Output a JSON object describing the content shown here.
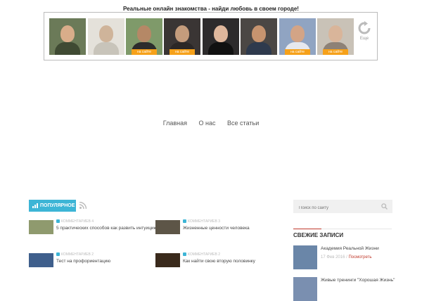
{
  "banner": {
    "title": "Реальные онлайн знакомства - найди любовь в своем городе!",
    "online_label": "на сайте",
    "more_label": "Еще",
    "photos": [
      {
        "bg": "#6b7a58",
        "skin": "#d9ad8a",
        "body": "#3f4a33",
        "online": false
      },
      {
        "bg": "#e4e1da",
        "skin": "#cfb49a",
        "body": "#c8c4ba",
        "online": false
      },
      {
        "bg": "#7f9a6a",
        "skin": "#b58866",
        "body": "#2c2c2c",
        "online": true
      },
      {
        "bg": "#3a3534",
        "skin": "#c49c7c",
        "body": "#2b2726",
        "online": true
      },
      {
        "bg": "#2d2b2c",
        "skin": "#dfb79c",
        "body": "#111111",
        "online": false
      },
      {
        "bg": "#4b4744",
        "skin": "#c7946f",
        "body": "#2e3a4d",
        "online": false
      },
      {
        "bg": "#90a4c2",
        "skin": "#d3a486",
        "body": "#e6e8ee",
        "online": true
      },
      {
        "bg": "#c9c2b7",
        "skin": "#d9b59a",
        "body": "#8d8176",
        "online": true
      }
    ]
  },
  "nav": [
    "Главная",
    "О нас",
    "Все статьи"
  ],
  "popular": {
    "tab_label": "ПОПУЛЯРНОЕ",
    "posts": [
      {
        "comments": "КОММЕНТАРИЕВ 4",
        "title": "5 практических способов как развить интуицию",
        "thumb": "#8f9a6e"
      },
      {
        "comments": "КОММЕНТАРИЕВ 3",
        "title": "Жизненные ценности человека",
        "thumb": "#5d5547"
      },
      {
        "comments": "КОММЕНТАРИЕВ 2",
        "title": "Тест на профориентацию",
        "thumb": "#3f5f8c"
      },
      {
        "comments": "КОММЕНТАРИЕВ 2",
        "title": "Как найти свою вторую половинку",
        "thumb": "#3a2a1c"
      }
    ]
  },
  "sidebar": {
    "search_placeholder": "Поиск по сайту",
    "recent_heading": "СВЕЖИЕ ЗАПИСИ",
    "recent": [
      {
        "title": "Академия Реальной Жизни",
        "date": "17 Фев 2016 /",
        "action": "Посмотреть",
        "thumb": "#6a86a8"
      },
      {
        "title": "Живые тренинги \"Хорошая Жизнь\"",
        "date": "",
        "action": "",
        "thumb": "#7a8fb0"
      }
    ]
  },
  "colors": {
    "accent": "#3db5d6",
    "highlight": "#c0392b",
    "online": "#f6a11a"
  }
}
